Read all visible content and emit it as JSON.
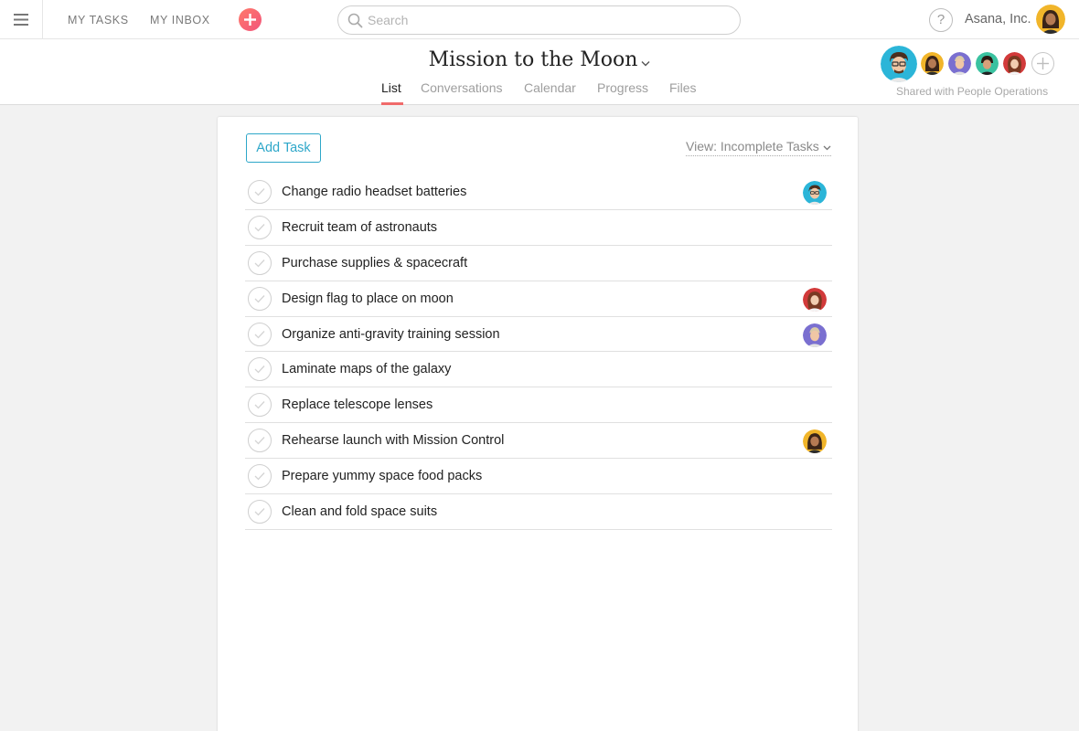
{
  "topbar": {
    "my_tasks": "MY TASKS",
    "my_inbox": "MY INBOX",
    "search_placeholder": "Search",
    "help_glyph": "?",
    "org_name": "Asana, Inc."
  },
  "project": {
    "title": "Mission to the Moon",
    "tabs": [
      {
        "label": "List",
        "active": true
      },
      {
        "label": "Conversations",
        "active": false
      },
      {
        "label": "Calendar",
        "active": false
      },
      {
        "label": "Progress",
        "active": false
      },
      {
        "label": "Files",
        "active": false
      }
    ],
    "shared_with": "Shared with People Operations"
  },
  "list": {
    "add_task_label": "Add Task",
    "view_filter": "View: Incomplete Tasks",
    "tasks": [
      {
        "name": "Change radio headset batteries",
        "has_assignee": true
      },
      {
        "name": "Recruit team of astronauts",
        "has_assignee": false
      },
      {
        "name": "Purchase supplies & spacecraft",
        "has_assignee": false
      },
      {
        "name": "Design flag to place on moon",
        "has_assignee": true
      },
      {
        "name": "Organize anti-gravity training session",
        "has_assignee": true
      },
      {
        "name": "Laminate maps of the galaxy",
        "has_assignee": false
      },
      {
        "name": "Replace telescope lenses",
        "has_assignee": false
      },
      {
        "name": "Rehearse launch with Mission Control",
        "has_assignee": true
      },
      {
        "name": "Prepare yummy space food packs",
        "has_assignee": false
      },
      {
        "name": "Clean and fold space suits",
        "has_assignee": false
      }
    ]
  },
  "icons": {
    "menu": "hamburger-icon",
    "quick_add": "plus-icon",
    "search": "search-icon",
    "help": "help-icon",
    "dropdown": "chevron-down-icon",
    "complete": "checkmark-icon",
    "add_member": "plus-icon"
  },
  "colors": {
    "accent": "#2ea7c9",
    "quick_add": "#f2547a",
    "tab_underline": "#f06a6a"
  }
}
